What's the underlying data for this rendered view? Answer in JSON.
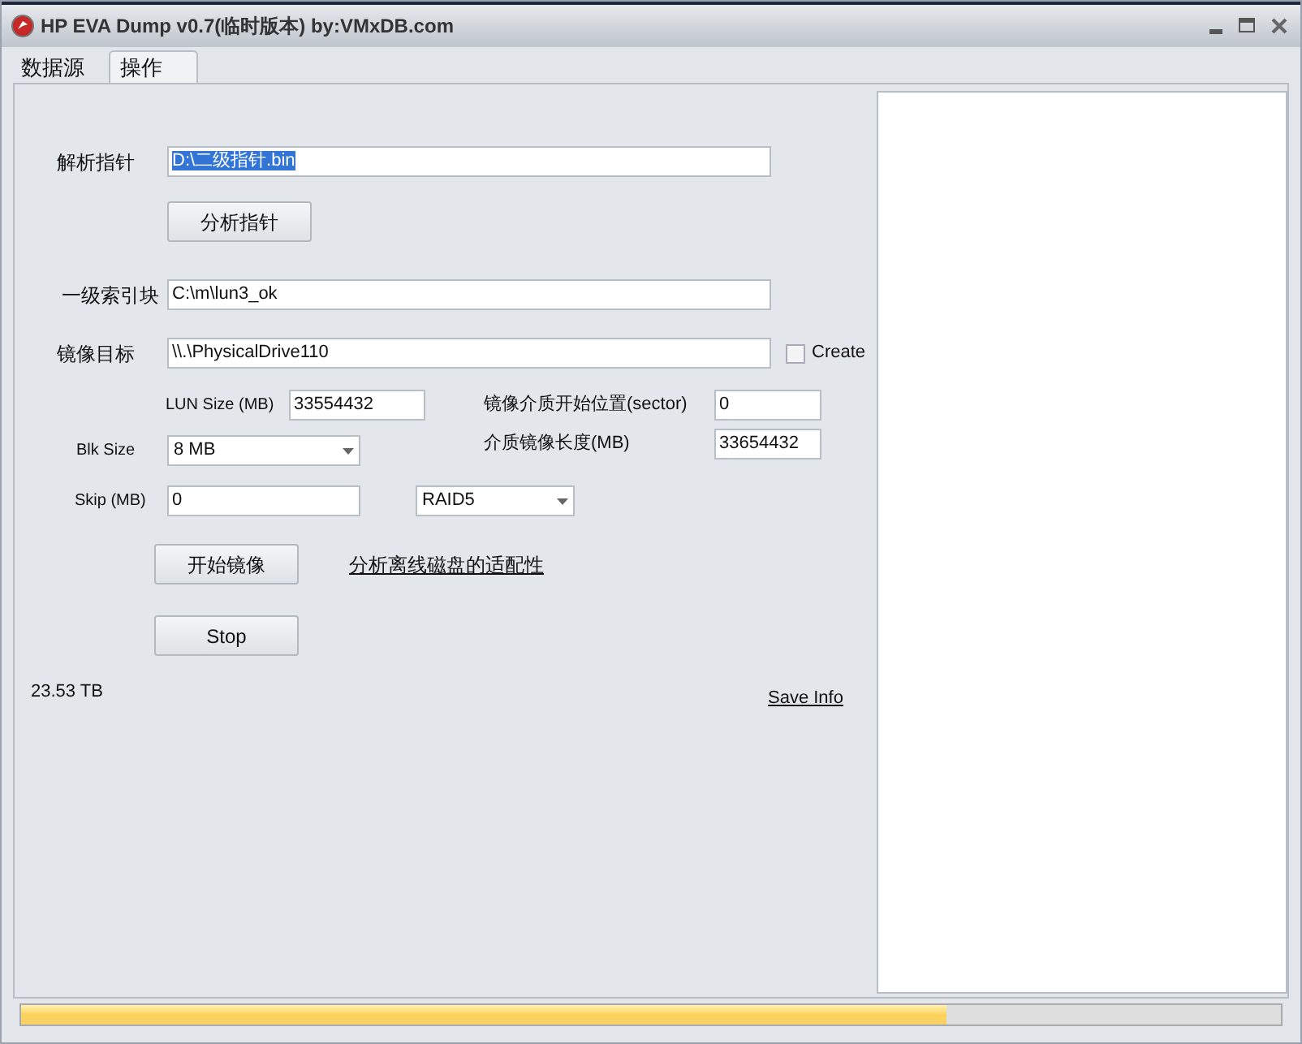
{
  "window": {
    "title": "HP EVA Dump v0.7(临时版本) by:VMxDB.com"
  },
  "tabs": [
    {
      "label": "数据源",
      "selected": false
    },
    {
      "label": "操作",
      "selected": true
    }
  ],
  "form": {
    "pointer": {
      "label": "解析指针",
      "value": "D:\\二级指针.bin",
      "highlighted": true
    },
    "analyze_button": "分析指针",
    "index_block": {
      "label": "一级索引块",
      "value": "C:\\m\\lun3_ok"
    },
    "target": {
      "label": "镜像目标",
      "value": "\\\\.\\PhysicalDrive110"
    },
    "create": {
      "label": "Create",
      "checked": false
    },
    "lun_size": {
      "label": "LUN Size (MB)",
      "value": "33554432"
    },
    "start_sector": {
      "label": "镜像介质开始位置(sector)",
      "value": "0"
    },
    "blk_size": {
      "label": "Blk Size",
      "value": "8 MB"
    },
    "image_length": {
      "label": "介质镜像长度(MB)",
      "value": "33654432"
    },
    "skip": {
      "label": "Skip (MB)",
      "value": "0"
    },
    "raid": {
      "value": "RAID5"
    },
    "start_button": "开始镜像",
    "link": "分析离线磁盘的适配性",
    "stop_button": "Stop",
    "capacity": "23.53 TB",
    "save_info": "Save Info"
  },
  "progress": {
    "level": 0.735
  }
}
